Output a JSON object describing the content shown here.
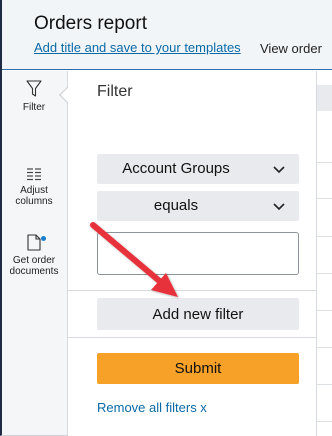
{
  "header": {
    "title": "Orders report",
    "add_title_link": "Add title and save to your templates",
    "view_orders": "View order"
  },
  "rail": {
    "filter_label": "Filter",
    "adjust_label_line1": "Adjust",
    "adjust_label_line2": "columns",
    "docs_label_line1": "Get order",
    "docs_label_line2": "documents"
  },
  "filter_panel": {
    "title": "Filter",
    "field_select": {
      "value": "Account Groups"
    },
    "operator_select": {
      "value": "equals"
    },
    "value_input": {
      "value": "",
      "placeholder": ""
    },
    "add_filter_label": "Add new filter",
    "submit_label": "Submit",
    "remove_all_label": "Remove all filters x"
  },
  "colors": {
    "accent_orange": "#f7a128",
    "link_blue": "#0a6aa8",
    "annotation_arrow": "#e8313b",
    "notification_dot": "#1a7fd0"
  }
}
